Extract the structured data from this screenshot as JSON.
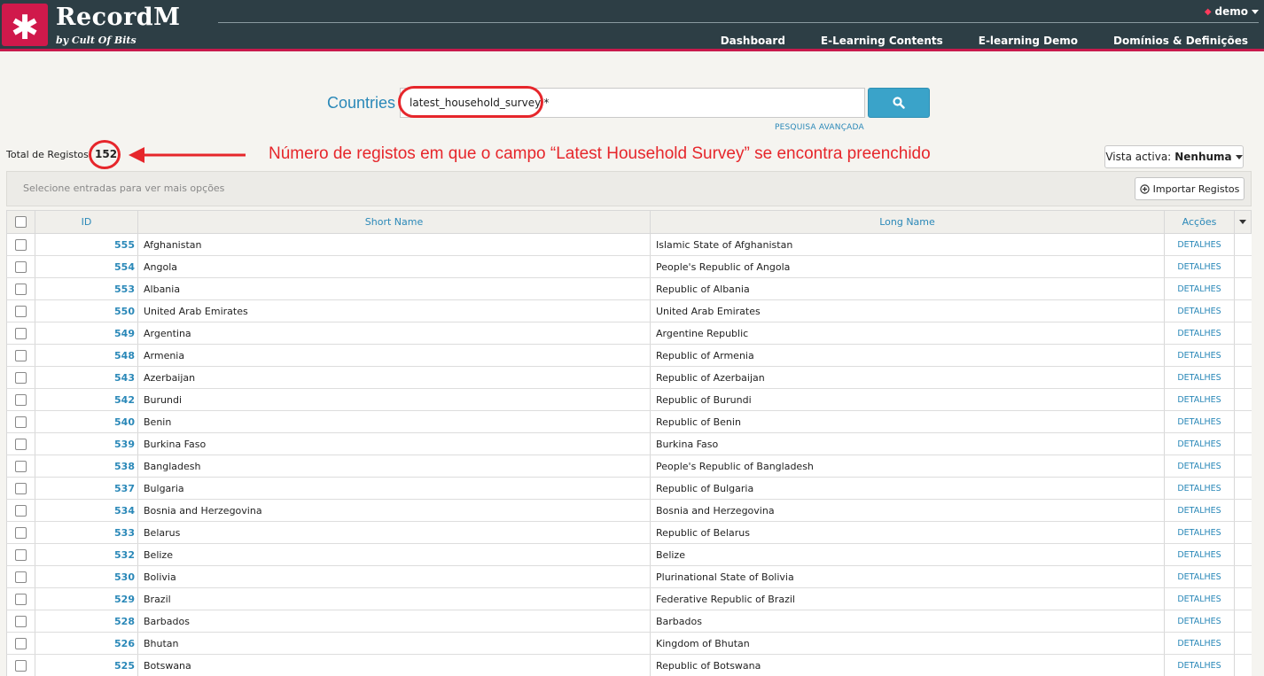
{
  "header": {
    "logo_glyph": "✱",
    "brand": "RecordM",
    "brand_sub": "by Cult Of Bits",
    "user": "demo",
    "nav": [
      "Dashboard",
      "E-Learning Contents",
      "E-learning Demo",
      "Domínios & Definições"
    ],
    "accent_color": "#c8194c"
  },
  "search": {
    "label": "Countries",
    "value": "latest_household_survey:*",
    "advanced_link": "PESQUISA AVANÇADA",
    "button_icon": "search-icon"
  },
  "summary": {
    "total_label": "Total de Registos:",
    "total_count": "152",
    "annotation": "Número de registos em que o campo “Latest Household Survey” se encontra preenchido"
  },
  "view": {
    "label": "Vista activa:",
    "value": "Nenhuma"
  },
  "toolbar": {
    "hint": "Selecione entradas para ver mais opções",
    "import_label": "Importar Registos"
  },
  "table": {
    "columns": [
      "ID",
      "Short Name",
      "Long Name",
      "Acções"
    ],
    "rows": [
      {
        "id": "555",
        "short": "Afghanistan",
        "long": "Islamic State of Afghanistan",
        "action": "DETALHES"
      },
      {
        "id": "554",
        "short": "Angola",
        "long": "People's Republic of Angola",
        "action": "DETALHES"
      },
      {
        "id": "553",
        "short": "Albania",
        "long": "Republic of Albania",
        "action": "DETALHES"
      },
      {
        "id": "550",
        "short": "United Arab Emirates",
        "long": "United Arab Emirates",
        "action": "DETALHES"
      },
      {
        "id": "549",
        "short": "Argentina",
        "long": "Argentine Republic",
        "action": "DETALHES"
      },
      {
        "id": "548",
        "short": "Armenia",
        "long": "Republic of Armenia",
        "action": "DETALHES"
      },
      {
        "id": "543",
        "short": "Azerbaijan",
        "long": "Republic of Azerbaijan",
        "action": "DETALHES"
      },
      {
        "id": "542",
        "short": "Burundi",
        "long": "Republic of Burundi",
        "action": "DETALHES"
      },
      {
        "id": "540",
        "short": "Benin",
        "long": "Republic of Benin",
        "action": "DETALHES"
      },
      {
        "id": "539",
        "short": "Burkina Faso",
        "long": "Burkina Faso",
        "action": "DETALHES"
      },
      {
        "id": "538",
        "short": "Bangladesh",
        "long": "People's Republic of Bangladesh",
        "action": "DETALHES"
      },
      {
        "id": "537",
        "short": "Bulgaria",
        "long": "Republic of Bulgaria",
        "action": "DETALHES"
      },
      {
        "id": "534",
        "short": "Bosnia and Herzegovina",
        "long": "Bosnia and Herzegovina",
        "action": "DETALHES"
      },
      {
        "id": "533",
        "short": "Belarus",
        "long": "Republic of Belarus",
        "action": "DETALHES"
      },
      {
        "id": "532",
        "short": "Belize",
        "long": "Belize",
        "action": "DETALHES"
      },
      {
        "id": "530",
        "short": "Bolivia",
        "long": "Plurinational State of Bolivia",
        "action": "DETALHES"
      },
      {
        "id": "529",
        "short": "Brazil",
        "long": "Federative Republic of Brazil",
        "action": "DETALHES"
      },
      {
        "id": "528",
        "short": "Barbados",
        "long": "Barbados",
        "action": "DETALHES"
      },
      {
        "id": "526",
        "short": "Bhutan",
        "long": "Kingdom of Bhutan",
        "action": "DETALHES"
      },
      {
        "id": "525",
        "short": "Botswana",
        "long": "Republic of Botswana",
        "action": "DETALHES"
      }
    ]
  }
}
